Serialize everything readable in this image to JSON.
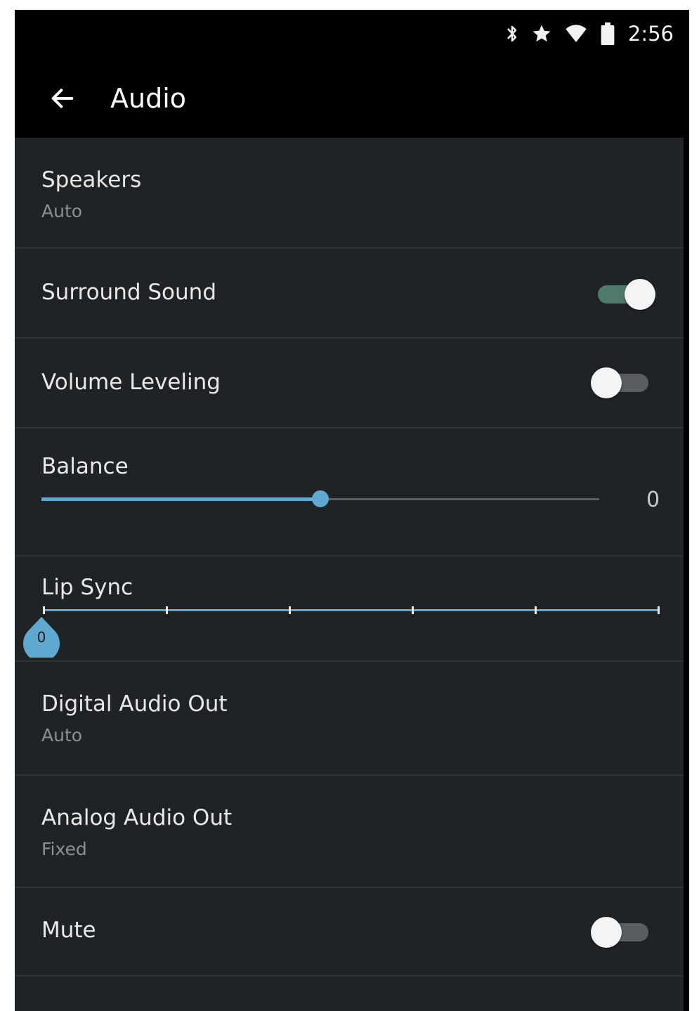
{
  "status_bar": {
    "time": "2:56",
    "icons": [
      "bluetooth-icon",
      "star-icon",
      "wifi-icon",
      "battery-icon"
    ]
  },
  "app_bar": {
    "title": "Audio",
    "back_icon": "arrow-left-icon"
  },
  "settings": {
    "speakers": {
      "label": "Speakers",
      "value": "Auto"
    },
    "surround_sound": {
      "label": "Surround Sound",
      "enabled": true
    },
    "volume_leveling": {
      "label": "Volume Leveling",
      "enabled": false
    },
    "balance": {
      "label": "Balance",
      "value": "0",
      "position_fraction": 0.5
    },
    "lip_sync": {
      "label": "Lip Sync",
      "value": "0",
      "ticks": 6,
      "position_fraction": 0
    },
    "digital_audio_out": {
      "label": "Digital Audio Out",
      "value": "Auto"
    },
    "analog_audio_out": {
      "label": "Analog Audio Out",
      "value": "Fixed"
    },
    "mute": {
      "label": "Mute",
      "enabled": false
    }
  },
  "colors": {
    "accent": "#5fa8cf",
    "toggle_on_track": "#4f7a6a",
    "toggle_off_track": "#5a5e61",
    "background": "#202326",
    "header": "#000000"
  }
}
